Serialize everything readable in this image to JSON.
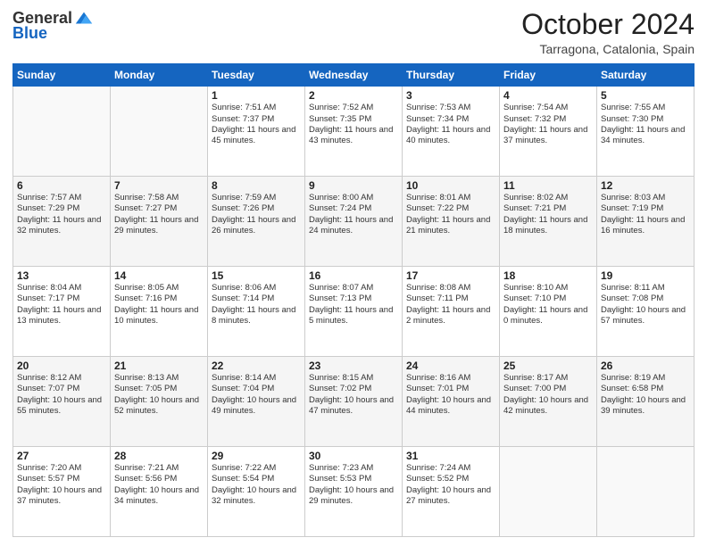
{
  "header": {
    "logo_general": "General",
    "logo_blue": "Blue",
    "month": "October 2024",
    "location": "Tarragona, Catalonia, Spain"
  },
  "calendar": {
    "days_of_week": [
      "Sunday",
      "Monday",
      "Tuesday",
      "Wednesday",
      "Thursday",
      "Friday",
      "Saturday"
    ],
    "weeks": [
      [
        {
          "day": "",
          "content": ""
        },
        {
          "day": "",
          "content": ""
        },
        {
          "day": "1",
          "content": "Sunrise: 7:51 AM\nSunset: 7:37 PM\nDaylight: 11 hours and 45 minutes."
        },
        {
          "day": "2",
          "content": "Sunrise: 7:52 AM\nSunset: 7:35 PM\nDaylight: 11 hours and 43 minutes."
        },
        {
          "day": "3",
          "content": "Sunrise: 7:53 AM\nSunset: 7:34 PM\nDaylight: 11 hours and 40 minutes."
        },
        {
          "day": "4",
          "content": "Sunrise: 7:54 AM\nSunset: 7:32 PM\nDaylight: 11 hours and 37 minutes."
        },
        {
          "day": "5",
          "content": "Sunrise: 7:55 AM\nSunset: 7:30 PM\nDaylight: 11 hours and 34 minutes."
        }
      ],
      [
        {
          "day": "6",
          "content": "Sunrise: 7:57 AM\nSunset: 7:29 PM\nDaylight: 11 hours and 32 minutes."
        },
        {
          "day": "7",
          "content": "Sunrise: 7:58 AM\nSunset: 7:27 PM\nDaylight: 11 hours and 29 minutes."
        },
        {
          "day": "8",
          "content": "Sunrise: 7:59 AM\nSunset: 7:26 PM\nDaylight: 11 hours and 26 minutes."
        },
        {
          "day": "9",
          "content": "Sunrise: 8:00 AM\nSunset: 7:24 PM\nDaylight: 11 hours and 24 minutes."
        },
        {
          "day": "10",
          "content": "Sunrise: 8:01 AM\nSunset: 7:22 PM\nDaylight: 11 hours and 21 minutes."
        },
        {
          "day": "11",
          "content": "Sunrise: 8:02 AM\nSunset: 7:21 PM\nDaylight: 11 hours and 18 minutes."
        },
        {
          "day": "12",
          "content": "Sunrise: 8:03 AM\nSunset: 7:19 PM\nDaylight: 11 hours and 16 minutes."
        }
      ],
      [
        {
          "day": "13",
          "content": "Sunrise: 8:04 AM\nSunset: 7:17 PM\nDaylight: 11 hours and 13 minutes."
        },
        {
          "day": "14",
          "content": "Sunrise: 8:05 AM\nSunset: 7:16 PM\nDaylight: 11 hours and 10 minutes."
        },
        {
          "day": "15",
          "content": "Sunrise: 8:06 AM\nSunset: 7:14 PM\nDaylight: 11 hours and 8 minutes."
        },
        {
          "day": "16",
          "content": "Sunrise: 8:07 AM\nSunset: 7:13 PM\nDaylight: 11 hours and 5 minutes."
        },
        {
          "day": "17",
          "content": "Sunrise: 8:08 AM\nSunset: 7:11 PM\nDaylight: 11 hours and 2 minutes."
        },
        {
          "day": "18",
          "content": "Sunrise: 8:10 AM\nSunset: 7:10 PM\nDaylight: 11 hours and 0 minutes."
        },
        {
          "day": "19",
          "content": "Sunrise: 8:11 AM\nSunset: 7:08 PM\nDaylight: 10 hours and 57 minutes."
        }
      ],
      [
        {
          "day": "20",
          "content": "Sunrise: 8:12 AM\nSunset: 7:07 PM\nDaylight: 10 hours and 55 minutes."
        },
        {
          "day": "21",
          "content": "Sunrise: 8:13 AM\nSunset: 7:05 PM\nDaylight: 10 hours and 52 minutes."
        },
        {
          "day": "22",
          "content": "Sunrise: 8:14 AM\nSunset: 7:04 PM\nDaylight: 10 hours and 49 minutes."
        },
        {
          "day": "23",
          "content": "Sunrise: 8:15 AM\nSunset: 7:02 PM\nDaylight: 10 hours and 47 minutes."
        },
        {
          "day": "24",
          "content": "Sunrise: 8:16 AM\nSunset: 7:01 PM\nDaylight: 10 hours and 44 minutes."
        },
        {
          "day": "25",
          "content": "Sunrise: 8:17 AM\nSunset: 7:00 PM\nDaylight: 10 hours and 42 minutes."
        },
        {
          "day": "26",
          "content": "Sunrise: 8:19 AM\nSunset: 6:58 PM\nDaylight: 10 hours and 39 minutes."
        }
      ],
      [
        {
          "day": "27",
          "content": "Sunrise: 7:20 AM\nSunset: 5:57 PM\nDaylight: 10 hours and 37 minutes."
        },
        {
          "day": "28",
          "content": "Sunrise: 7:21 AM\nSunset: 5:56 PM\nDaylight: 10 hours and 34 minutes."
        },
        {
          "day": "29",
          "content": "Sunrise: 7:22 AM\nSunset: 5:54 PM\nDaylight: 10 hours and 32 minutes."
        },
        {
          "day": "30",
          "content": "Sunrise: 7:23 AM\nSunset: 5:53 PM\nDaylight: 10 hours and 29 minutes."
        },
        {
          "day": "31",
          "content": "Sunrise: 7:24 AM\nSunset: 5:52 PM\nDaylight: 10 hours and 27 minutes."
        },
        {
          "day": "",
          "content": ""
        },
        {
          "day": "",
          "content": ""
        }
      ]
    ]
  }
}
